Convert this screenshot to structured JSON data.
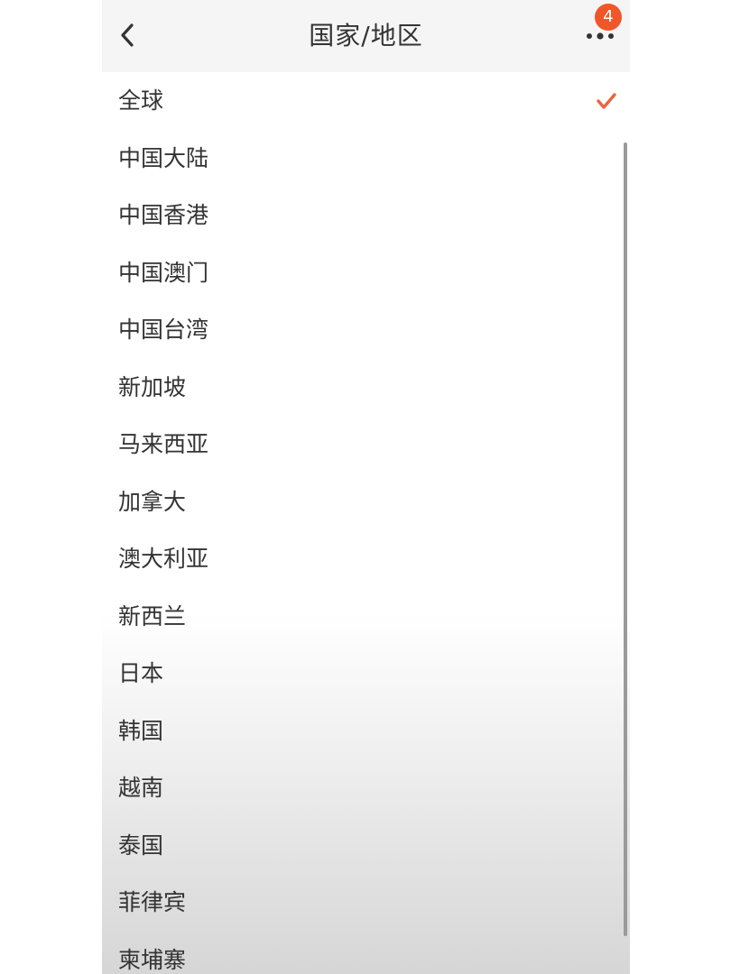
{
  "header": {
    "title": "国家/地区",
    "badge_count": "4",
    "back_icon": "chevron-left-icon",
    "more_icon": "more-dots-icon"
  },
  "list": {
    "selected_index": 0,
    "items": [
      {
        "label": "全球"
      },
      {
        "label": "中国大陆"
      },
      {
        "label": "中国香港"
      },
      {
        "label": "中国澳门"
      },
      {
        "label": "中国台湾"
      },
      {
        "label": "新加坡"
      },
      {
        "label": "马来西亚"
      },
      {
        "label": "加拿大"
      },
      {
        "label": "澳大利亚"
      },
      {
        "label": "新西兰"
      },
      {
        "label": "日本"
      },
      {
        "label": "韩国"
      },
      {
        "label": "越南"
      },
      {
        "label": "泰国"
      },
      {
        "label": "菲律宾"
      },
      {
        "label": "柬埔寨"
      }
    ]
  },
  "colors": {
    "accent": "#e8663d",
    "badge": "#f0562a",
    "text": "#333333",
    "header_bg": "#f5f5f5"
  }
}
